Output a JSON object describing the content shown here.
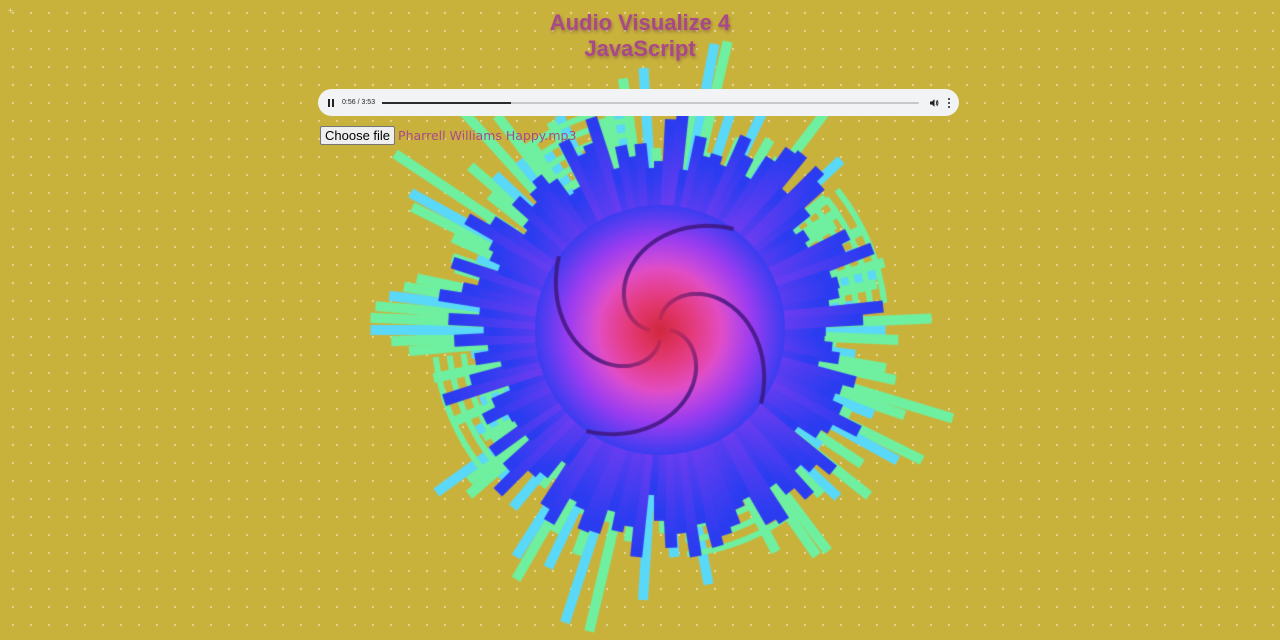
{
  "page": {
    "title_line1": "Audio Visualize 4",
    "title_line2": "JavaScript"
  },
  "player": {
    "time_display": "0:56 / 3:53",
    "progress_fraction": 0.24,
    "pause_icon": "pause-icon",
    "volume_icon": "volume-icon",
    "more_icon": "more-options-icon"
  },
  "file_input": {
    "button_label": "Choose file",
    "file_name": "Pharrell Williams Happy.mp3"
  },
  "colors": {
    "background": "#c9b23c",
    "title": "#a9498a",
    "viz_outer": "#6ef0a0",
    "viz_mid": "#2b3cf0",
    "viz_inner": "#f03c78",
    "viz_cyan": "#5ad8f8",
    "viz_purple": "#9a3cf0"
  }
}
